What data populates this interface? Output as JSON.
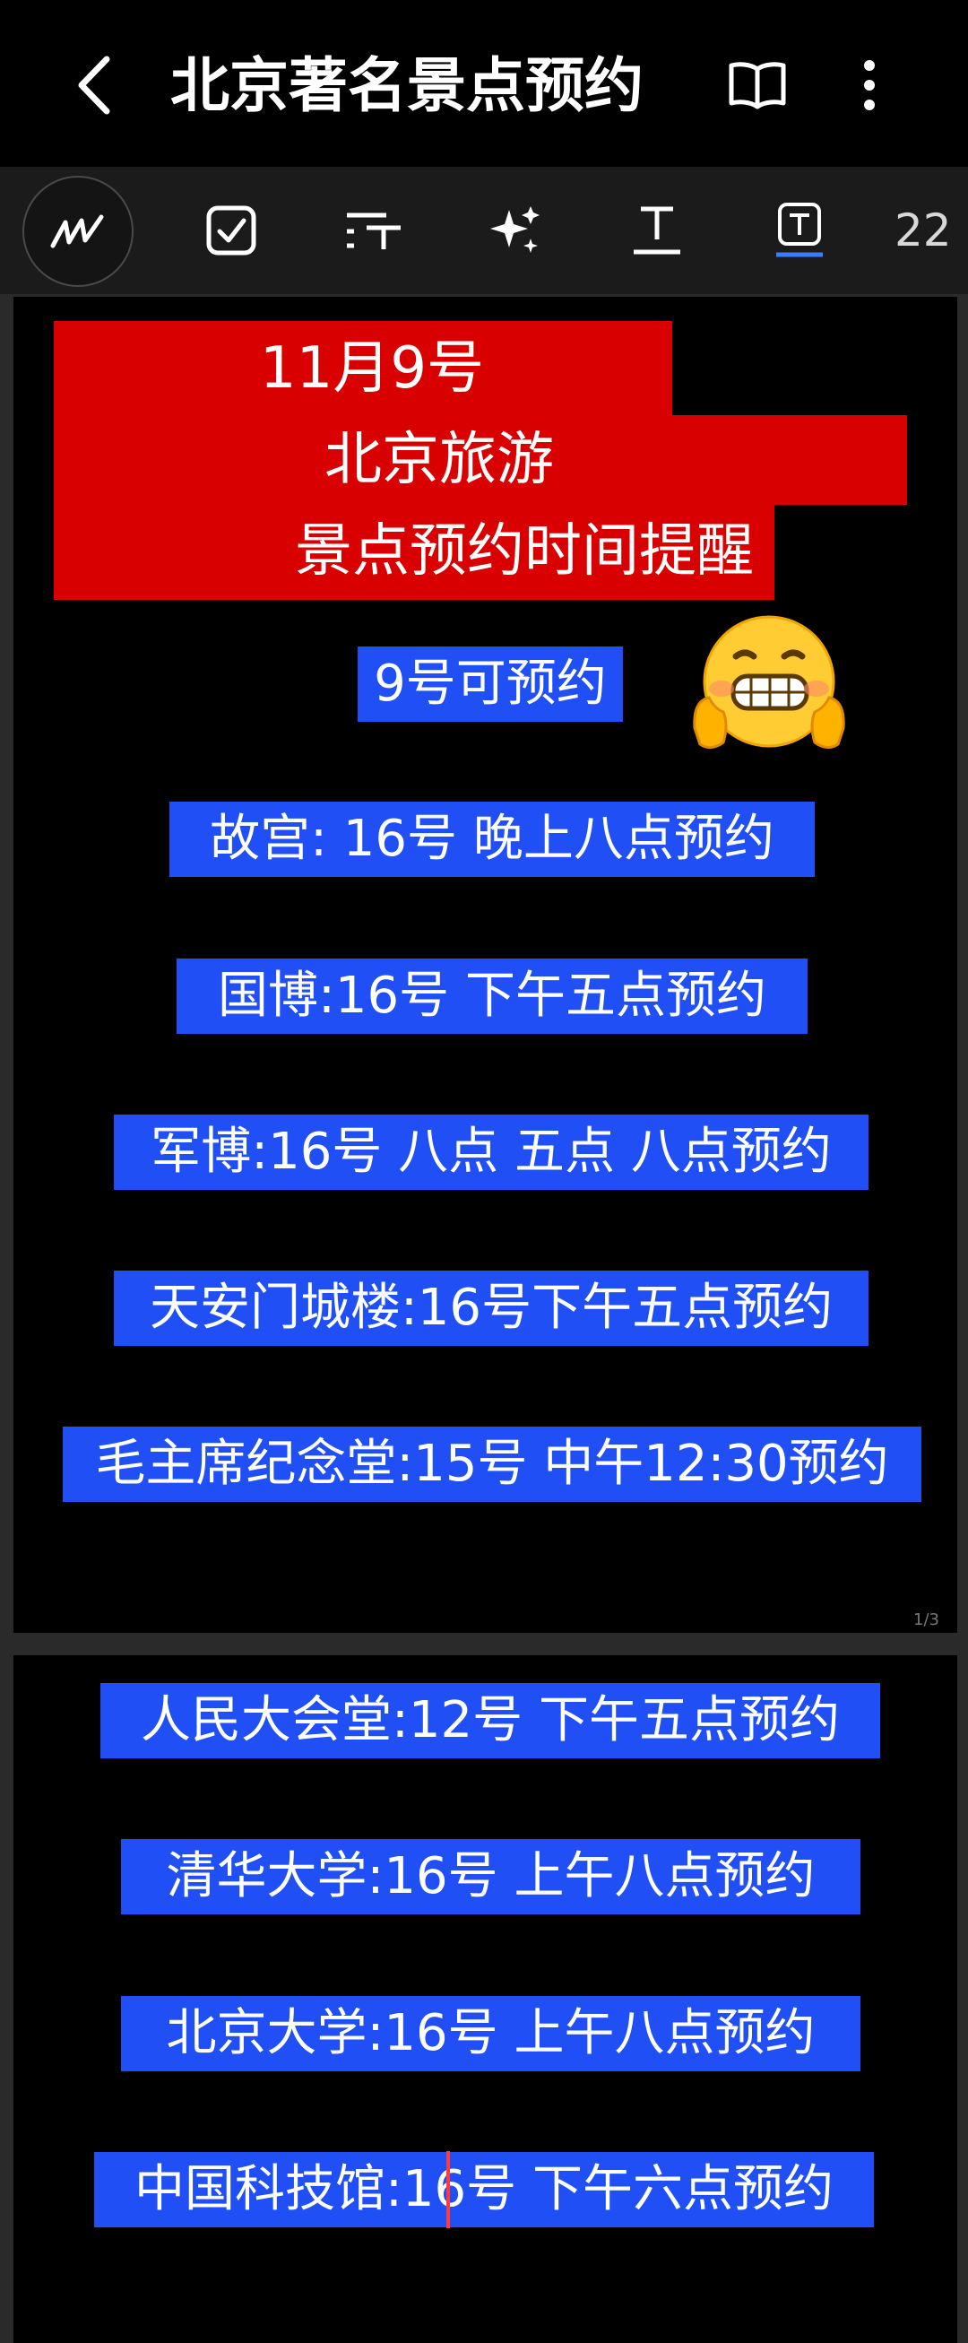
{
  "header": {
    "title": "北京著名景点预约"
  },
  "toolbar": {
    "size_label": "22",
    "tools": [
      "pen-tool",
      "checkbox-tool",
      "text-size-tool",
      "sparkle-tool",
      "text-underline-tool",
      "text-box-tool"
    ]
  },
  "banner": {
    "line1": "11月9号",
    "line2": "北京旅游",
    "line3": "景点预约时间提醒"
  },
  "notice": "9号可预约",
  "schedule": [
    "故宫:  16号  晚上八点预约",
    "国博:16号   下午五点预约",
    "军博:16号  八点 五点 八点预约",
    "天安门城楼:16号下午五点预约",
    "毛主席纪念堂:15号 中午12:30预约",
    "人民大会堂:12号  下午五点预约",
    "清华大学:16号   上午八点预约",
    "北京大学:16号   上午八点预约",
    "中国科技馆:16号   下午六点预约"
  ],
  "page1_number": "1/3",
  "colors": {
    "banner_red": "#d80000",
    "highlight_blue": "#1f4ff5",
    "cursor_red": "#ff3b3b"
  }
}
